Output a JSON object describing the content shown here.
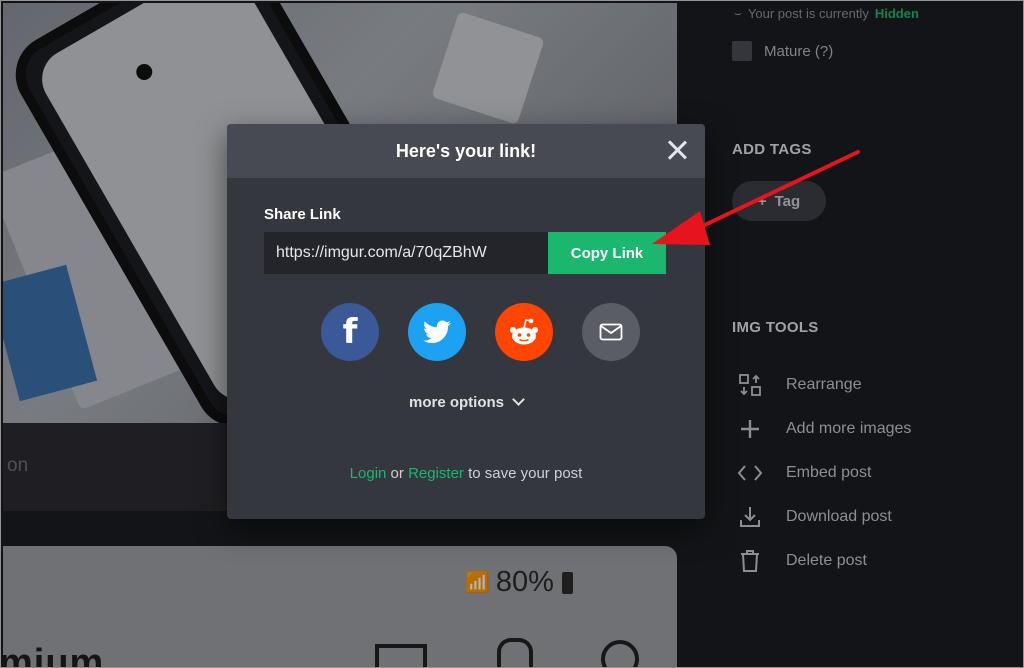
{
  "sidebar": {
    "post_status_prefix": "Your post is currently",
    "post_status_value": "Hidden",
    "mature_label": "Mature (?)",
    "add_tags_title": "ADD TAGS",
    "tag_button": "Tag",
    "img_tools_title": "IMG TOOLS",
    "tools": [
      {
        "label": "Rearrange",
        "icon": "rearrange-icon"
      },
      {
        "label": "Add more images",
        "icon": "plus-icon"
      },
      {
        "label": "Embed post",
        "icon": "code-icon"
      },
      {
        "label": "Download post",
        "icon": "download-icon"
      },
      {
        "label": "Delete post",
        "icon": "trash-icon"
      }
    ]
  },
  "background": {
    "caption_fragment": "on",
    "status_percent": "80%",
    "partial_title": "mium"
  },
  "modal": {
    "title": "Here's your link!",
    "share_label": "Share Link",
    "link_value": "https://imgur.com/a/70qZBhW",
    "copy_button": "Copy Link",
    "socials": [
      "facebook-icon",
      "twitter-icon",
      "reddit-icon",
      "email-icon"
    ],
    "more_options": "more options",
    "login": "Login",
    "or": "or",
    "register": "Register",
    "save_suffix": "to save your post"
  },
  "colors": {
    "accent_green": "#1bb76e",
    "arrow_red": "#e8141c",
    "facebook": "#3b5998",
    "twitter": "#1da1f2",
    "reddit": "#ff4500"
  }
}
